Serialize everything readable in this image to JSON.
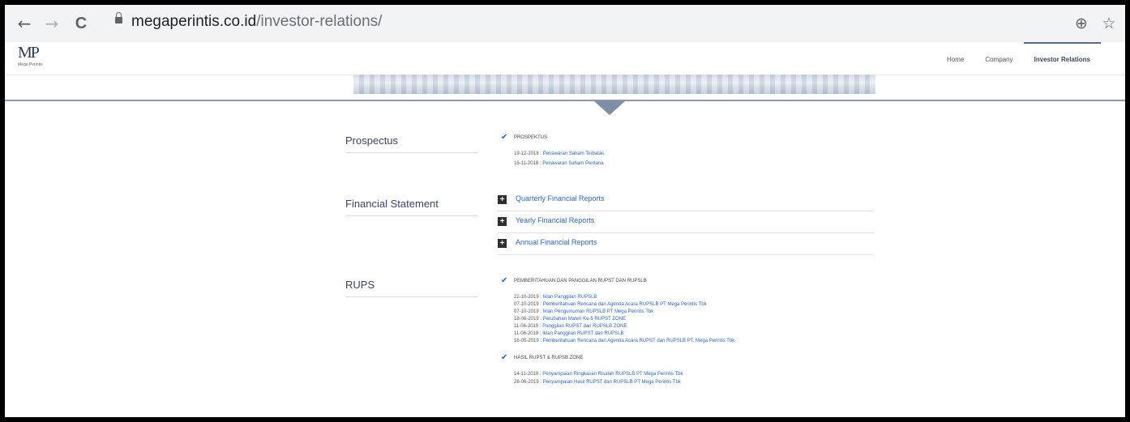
{
  "browser": {
    "url_host": "megaperintis.co.id",
    "url_path": "/investor-relations/",
    "back_glyph": "←",
    "forward_glyph": "→",
    "reload_glyph": "C",
    "zoom_glyph": "⊕",
    "star_glyph": "☆"
  },
  "site": {
    "logo_text": "MP",
    "logo_sub": "Mega Perintis",
    "nav": [
      "Home",
      "Company",
      "Investor Relations"
    ]
  },
  "prospectus": {
    "title": "Prospectus",
    "caption": "PROSPEKTUS",
    "items": [
      {
        "date": "19-12-2018 : ",
        "title": "Penawaran Saham Terbatas"
      },
      {
        "date": "16-11-2018 : ",
        "title": "Penawaran Saham Perdana"
      }
    ]
  },
  "financial": {
    "title": "Financial Statement",
    "reports": [
      "Quarterly Financial Reports",
      "Yearly Financial Reports",
      "Annual Financial Reports"
    ],
    "plus_glyph": "+"
  },
  "rups": {
    "title": "RUPS",
    "caption1": "PEMBERITAHUAN DAN PANGGILAN RUPST DAN RUPSLB",
    "items1": [
      {
        "date": "22-10-2019 : ",
        "title": "Iklan Panggilan RUPSLB"
      },
      {
        "date": "07-10-2019 : ",
        "title": "Pemberitahuan Rencana dan Agenda Acara RUPSLB PT Mega Perintis Tbk"
      },
      {
        "date": "07-10-2019 : ",
        "title": "Iklan Pengumuman RUPSLB PT Mega Perintis Tbk"
      },
      {
        "date": "18-06-2019 : ",
        "title": "Perubahan Materi Ke-5 RUPST ZONE"
      },
      {
        "date": "11-06-2019 : ",
        "title": "Panggilan RUPST dan RUPSLB ZONE"
      },
      {
        "date": "11-06-2019 : ",
        "title": "Iklan Panggilan RUPST dan RUPSLB"
      },
      {
        "date": "16-05-2019 : ",
        "title": "Pemberitahuan Rencana dan Agenda Acara RUPST dan RUPSLB PT. Mega Perintis Tbk"
      }
    ],
    "caption2": "HASIL RUPST & RUPSB ZONE",
    "items2": [
      {
        "date": "14-11-2019 : ",
        "title": "Penyampaian Ringkasan Risalah RUPSLB PT Mega Perintis Tbk"
      },
      {
        "date": "26-06-2019 : ",
        "title": "Penyampaian Hasil RUPST dan RUPSLB PT Mega Perintis Tbk"
      }
    ]
  },
  "colors": {
    "link": "#2a66c8",
    "heading": "#3a4560",
    "rule": "#8a97ad"
  }
}
